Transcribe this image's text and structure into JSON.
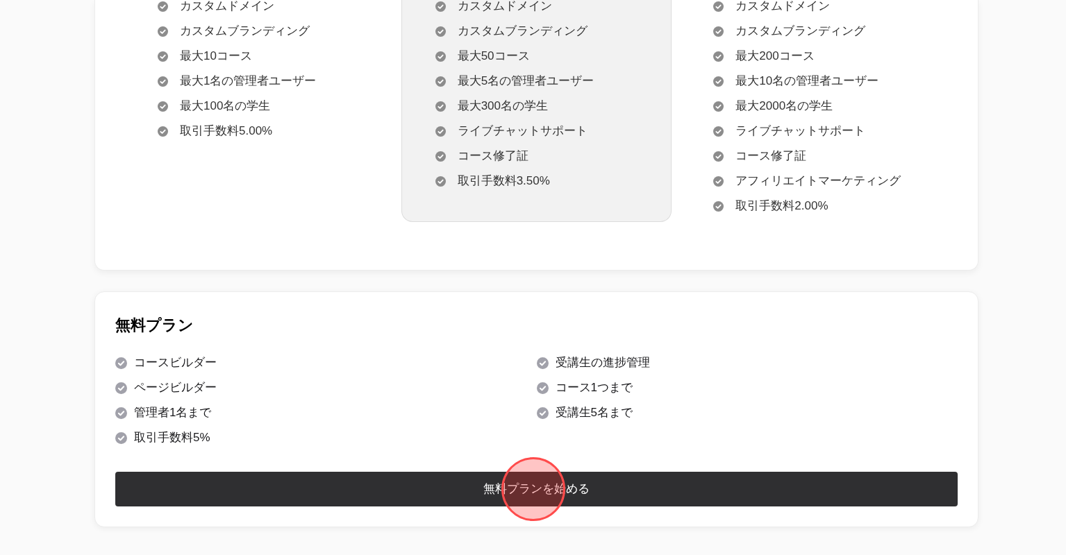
{
  "plan_columns": [
    {
      "highlighted": false,
      "features": [
        "カスタムドメイン",
        "カスタムブランディング",
        "最大10コース",
        "最大1名の管理者ユーザー",
        "最大100名の学生",
        "取引手数料5.00%"
      ]
    },
    {
      "highlighted": true,
      "features": [
        "カスタムドメイン",
        "カスタムブランディング",
        "最大50コース",
        "最大5名の管理者ユーザー",
        "最大300名の学生",
        "ライブチャットサポート",
        "コース修了証",
        "取引手数料3.50%"
      ]
    },
    {
      "highlighted": false,
      "features": [
        "カスタムドメイン",
        "カスタムブランディング",
        "最大200コース",
        "最大10名の管理者ユーザー",
        "最大2000名の学生",
        "ライブチャットサポート",
        "コース修了証",
        "アフィリエイトマーケティング",
        "取引手数料2.00%"
      ]
    }
  ],
  "free_plan": {
    "title": "無料プラン",
    "feature_columns": [
      [
        "コースビルダー",
        "ページビルダー",
        "管理者1名まで",
        "取引手数料5%"
      ],
      [
        "受講生の進捗管理",
        "コース1つまで",
        "受講生5名まで"
      ]
    ],
    "button": "無料プランを始める"
  }
}
